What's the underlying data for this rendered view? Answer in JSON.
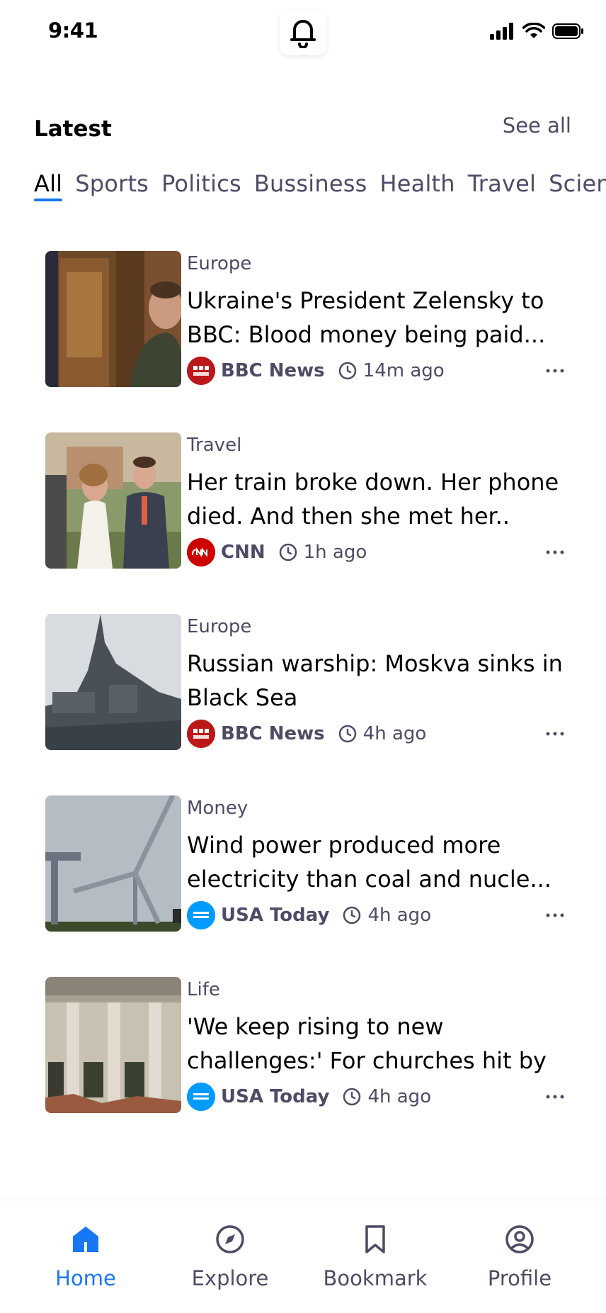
{
  "status_bar": {
    "time": "9:41"
  },
  "header": {
    "title": "Latest",
    "see_all": "See all"
  },
  "tabs": [
    {
      "label": "All",
      "active": true
    },
    {
      "label": "Sports"
    },
    {
      "label": "Politics"
    },
    {
      "label": "Bussiness"
    },
    {
      "label": "Health"
    },
    {
      "label": "Travel"
    },
    {
      "label": "Science"
    }
  ],
  "articles": [
    {
      "category": "Europe",
      "headline": "Ukraine's President Zelensky to BBC: Blood money being paid...",
      "source": "BBC News",
      "time": "14m ago",
      "logo_text": "BBC NEWS",
      "logo_color": "#bb1919",
      "thumb": "zelensky-photo"
    },
    {
      "category": "Travel",
      "headline": "Her train broke down. Her phone died. And then she met her..",
      "source": "CNN",
      "time": "1h ago",
      "logo_text": "CNN",
      "logo_color": "#cc0000",
      "thumb": "wedding-photo"
    },
    {
      "category": "Europe",
      "headline": "Russian warship: Moskva sinks in Black Sea",
      "source": "BBC News",
      "time": "4h ago",
      "logo_text": "BBC NEWS",
      "logo_color": "#bb1919",
      "thumb": "warship-photo"
    },
    {
      "category": "Money",
      "headline": "Wind power produced more electricity than coal and nucle...",
      "source": "USA Today",
      "time": "4h ago",
      "logo_text": "USA TODAY",
      "logo_color": "#009bff",
      "thumb": "wind-turbine-photo"
    },
    {
      "category": "Life",
      "headline": "'We keep rising to new challenges:' For churches hit by",
      "source": "USA Today",
      "time": "4h ago",
      "logo_text": "USA TODAY",
      "logo_color": "#009bff",
      "thumb": "church-ruins-photo"
    }
  ],
  "bottom_nav": [
    {
      "label": "Home",
      "icon": "home-icon",
      "active": true
    },
    {
      "label": "Explore",
      "icon": "compass-icon"
    },
    {
      "label": "Bookmark",
      "icon": "bookmark-icon"
    },
    {
      "label": "Profile",
      "icon": "profile-icon"
    }
  ],
  "colors": {
    "accent": "#1877f2",
    "secondary_text": "#4e4b66"
  }
}
